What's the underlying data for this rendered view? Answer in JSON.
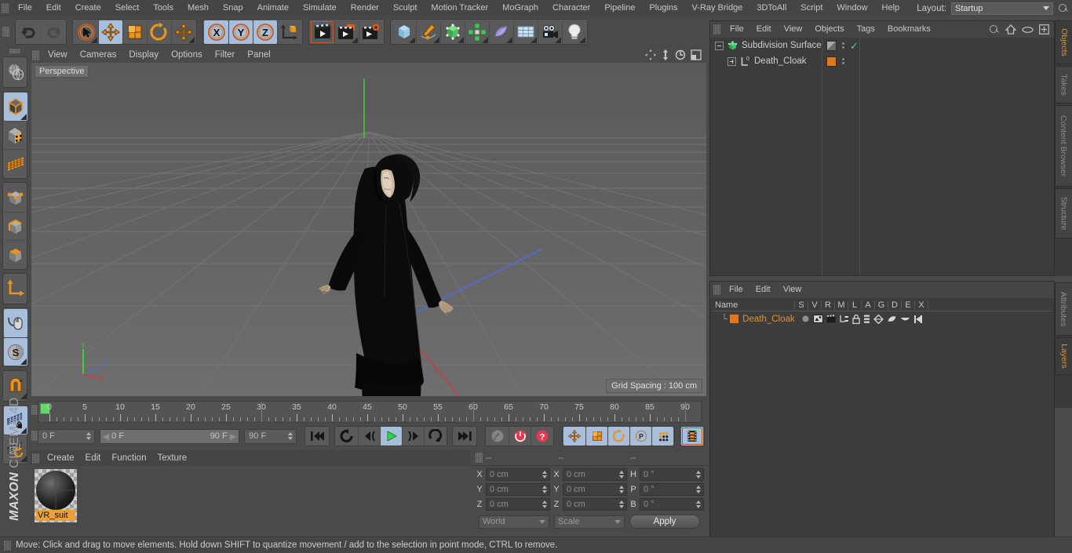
{
  "app": {
    "title": "MAXON CINEMA 4D",
    "brand_bold": "MAXON",
    "brand_light": "CINEMA 4D"
  },
  "menu": {
    "items": [
      "File",
      "Edit",
      "Create",
      "Select",
      "Tools",
      "Mesh",
      "Snap",
      "Animate",
      "Simulate",
      "Render",
      "Sculpt",
      "Motion Tracker",
      "MoGraph",
      "Character",
      "Pipeline",
      "Plugins",
      "V-Ray Bridge",
      "3DToAll",
      "Script",
      "Window",
      "Help"
    ],
    "layout_label": "Layout:",
    "layout_value": "Startup",
    "search_icon": "search-icon"
  },
  "toolbar": {
    "groups": [
      {
        "name": "undo-redo",
        "buttons": [
          {
            "name": "undo-button",
            "icon": "undo-arrow-icon",
            "active": false
          },
          {
            "name": "redo-button",
            "icon": "redo-arrow-icon",
            "active": false,
            "disabled": true
          }
        ]
      },
      {
        "name": "transform-tools",
        "buttons": [
          {
            "name": "live-selection-tool",
            "icon": "cursor-circle-icon",
            "active": false,
            "corner": true
          },
          {
            "name": "move-tool",
            "icon": "move-arrows-icon",
            "active": true
          },
          {
            "name": "scale-tool",
            "icon": "scale-box-icon",
            "active": false
          },
          {
            "name": "rotate-tool",
            "icon": "rotate-arc-icon",
            "active": false
          },
          {
            "name": "move-extra-tool",
            "icon": "move-arrows-icon",
            "active": false,
            "corner": true
          }
        ]
      },
      {
        "name": "axis-locks",
        "buttons": [
          {
            "name": "lock-x-axis",
            "icon": "x-axis-icon",
            "active": true,
            "label": "X"
          },
          {
            "name": "lock-y-axis",
            "icon": "y-axis-icon",
            "active": true,
            "label": "Y"
          },
          {
            "name": "lock-z-axis",
            "icon": "z-axis-icon",
            "active": true,
            "label": "Z"
          },
          {
            "name": "world-object-coordinate-toggle",
            "icon": "world-axis-cube-icon",
            "active": false
          }
        ]
      },
      {
        "name": "render-tools",
        "buttons": [
          {
            "name": "render-view-button",
            "icon": "clapper-frame-icon",
            "active": false,
            "highlight": true
          },
          {
            "name": "render-picture-viewer-button",
            "icon": "clapper-window-icon",
            "active": false,
            "corner": true
          },
          {
            "name": "render-settings-button",
            "icon": "clapper-gear-icon",
            "active": false
          }
        ]
      },
      {
        "name": "object-creation",
        "buttons": [
          {
            "name": "add-cube-primitive",
            "icon": "blue-cube-icon",
            "active": false,
            "corner": true
          },
          {
            "name": "add-spline",
            "icon": "pen-spline-icon",
            "active": false,
            "corner": true
          },
          {
            "name": "add-generator",
            "icon": "green-cube-nurbs-icon",
            "active": false,
            "corner": true
          },
          {
            "name": "add-array-object",
            "icon": "green-cluster-icon",
            "active": false,
            "corner": true
          },
          {
            "name": "add-deformer",
            "icon": "purple-bend-icon",
            "active": false,
            "corner": true
          },
          {
            "name": "add-environment",
            "icon": "grid-floor-icon",
            "active": false,
            "corner": true
          },
          {
            "name": "add-camera",
            "icon": "camera-icon",
            "active": false,
            "corner": true
          },
          {
            "name": "add-light",
            "icon": "light-bulb-icon",
            "active": false,
            "corner": true
          }
        ]
      }
    ]
  },
  "left_toolbar": {
    "groups": [
      {
        "buttons": [
          {
            "name": "make-editable-button",
            "icon": "sphere-wire-icon",
            "active": false
          }
        ]
      },
      {
        "buttons": [
          {
            "name": "model-mode-button",
            "icon": "model-cube-icon",
            "active": true,
            "corner": true
          },
          {
            "name": "texture-mode-button",
            "icon": "texture-checker-cube-icon",
            "active": false
          },
          {
            "name": "uv-mesh-mode-button",
            "icon": "uv-mesh-icon",
            "active": false
          }
        ]
      },
      {
        "buttons": [
          {
            "name": "point-mode-button",
            "icon": "point-cube-icon",
            "active": false
          },
          {
            "name": "edge-mode-button",
            "icon": "edge-cube-icon",
            "active": false
          },
          {
            "name": "polygon-mode-button",
            "icon": "polygon-cube-icon",
            "active": false
          }
        ]
      },
      {
        "buttons": [
          {
            "name": "axis-modify-button",
            "icon": "axis-corner-icon",
            "active": false
          }
        ]
      },
      {
        "buttons": [
          {
            "name": "enable-snap-button",
            "icon": "mouse-snap-icon",
            "active": true
          },
          {
            "name": "soft-selection-button",
            "icon": "soft-selection-s-icon",
            "active": true,
            "corner": true
          }
        ]
      },
      {
        "buttons": [
          {
            "name": "magnet-tool-button",
            "icon": "magnet-icon",
            "active": false,
            "corner": true
          }
        ]
      },
      {
        "buttons": [
          {
            "name": "lock-workplane-button",
            "icon": "workplane-lock-icon",
            "active": true,
            "corner": true
          },
          {
            "name": "planar-workplane-button",
            "icon": "workplane-rotate-icon",
            "active": false,
            "corner": true
          }
        ]
      }
    ]
  },
  "viewport": {
    "menu": [
      "View",
      "Cameras",
      "Display",
      "Options",
      "Filter",
      "Panel"
    ],
    "icons": [
      "move-view-icon",
      "zoom-view-icon",
      "rotate-view-icon",
      "maximize-view-icon"
    ],
    "label": "Perspective",
    "grid_spacing": "Grid Spacing : 100 cm",
    "axis_gizmo": {
      "y": "Y",
      "z": "Z",
      "x": "X",
      "y_color": "#3ecf3e",
      "z_color": "#4a6fe8",
      "x_color": "#e04040"
    },
    "object_name": "Death_Cloak"
  },
  "timeline": {
    "tick_labels": [
      "0",
      "5",
      "10",
      "15",
      "20",
      "25",
      "30",
      "35",
      "40",
      "45",
      "50",
      "55",
      "60",
      "65",
      "70",
      "75",
      "80",
      "85",
      "90"
    ],
    "tick_values": [
      0,
      5,
      10,
      15,
      20,
      25,
      30,
      35,
      40,
      45,
      50,
      55,
      60,
      65,
      70,
      75,
      80,
      85,
      90
    ],
    "range_min": 0,
    "range_max": 90,
    "current_frame": "0 F",
    "preview_min": "0 F",
    "preview_max": "90 F",
    "document_end": "90 F",
    "current_frame_right": "0 F",
    "controls": [
      {
        "name": "go-to-start-button",
        "icon": "skip-start-icon"
      },
      {
        "name": "play-backwards-button",
        "icon": "loop-back-icon"
      },
      {
        "name": "step-back-button",
        "icon": "step-back-icon"
      },
      {
        "name": "play-forward-button",
        "icon": "play-icon",
        "active": true
      },
      {
        "name": "step-forward-button",
        "icon": "step-forward-icon"
      },
      {
        "name": "play-loop-button",
        "icon": "loop-forward-icon"
      },
      {
        "name": "go-to-end-button",
        "icon": "skip-end-icon"
      },
      {
        "name": "record-active-objects-button",
        "icon": "key-disabled-icon"
      },
      {
        "name": "autokeying-button",
        "icon": "record-red-icon"
      },
      {
        "name": "keyframe-selection-button",
        "icon": "question-red-icon"
      },
      {
        "name": "position-key-button",
        "icon": "move-arrows-icon",
        "active": true
      },
      {
        "name": "scale-key-button",
        "icon": "scale-box-icon",
        "active": true
      },
      {
        "name": "rotation-key-button",
        "icon": "rotate-arc-icon",
        "active": true
      },
      {
        "name": "param-key-button",
        "icon": "p-circle-icon",
        "active": true
      },
      {
        "name": "point-level-animation-button",
        "icon": "dots-grid-icon",
        "active": true
      },
      {
        "name": "timeline-mode-button",
        "icon": "filmstrip-icon",
        "active": true,
        "highlight": true
      }
    ]
  },
  "materials": {
    "menu": [
      "Create",
      "Edit",
      "Function",
      "Texture"
    ],
    "items": [
      {
        "name": "VR_suit",
        "selected": true
      }
    ]
  },
  "coordinates": {
    "headers": [
      "--",
      "--",
      "--"
    ],
    "rows": [
      {
        "label_pos": "X",
        "pos": "0 cm",
        "label_size": "X",
        "size": "0 cm",
        "label_rot": "H",
        "rot": "0 °"
      },
      {
        "label_pos": "Y",
        "pos": "0 cm",
        "label_size": "Y",
        "size": "0 cm",
        "label_rot": "P",
        "rot": "0 °"
      },
      {
        "label_pos": "Z",
        "pos": "0 cm",
        "label_size": "Z",
        "size": "0 cm",
        "label_rot": "B",
        "rot": "0 °"
      }
    ],
    "coord_system": "World",
    "size_mode": "Scale",
    "apply_label": "Apply"
  },
  "object_manager": {
    "menu": [
      "File",
      "Edit",
      "View",
      "Objects",
      "Tags",
      "Bookmarks"
    ],
    "icons": [
      "search-icon",
      "home-icon",
      "eye-icon",
      "add-layer-icon"
    ],
    "items": [
      {
        "name": "Subdivision Surface",
        "icon": "subdivision-surface-icon",
        "icon_color": "#3ecf6b",
        "depth": 0,
        "expander": "minus",
        "tag_color": "#8f8f8f",
        "check": true
      },
      {
        "name": "Death_Cloak",
        "icon": "polygon-object-icon",
        "icon_color": "#cfcfcf",
        "depth": 1,
        "expander": "plus",
        "tag_color": "#e07820",
        "check": false
      }
    ]
  },
  "layer_manager": {
    "menu": [
      "File",
      "Edit",
      "View"
    ],
    "columns": [
      "Name",
      "S",
      "V",
      "R",
      "M",
      "L",
      "A",
      "G",
      "D",
      "E",
      "X"
    ],
    "rows": [
      {
        "name": "Death_Cloak",
        "swatch": "#e07820",
        "icons": [
          "solo-dot-icon",
          "visible-icon",
          "render-icon",
          "manager-icon",
          "lock-icon",
          "animation-icon",
          "generator-icon",
          "deformer-icon",
          "expression-icon",
          "xref-icon"
        ]
      }
    ]
  },
  "right_tabs": {
    "upper": [
      {
        "label": "Objects",
        "active": true
      },
      {
        "label": "Takes",
        "active": false
      },
      {
        "label": "Content Browser",
        "active": false
      },
      {
        "label": "Structure",
        "active": false
      }
    ],
    "lower": [
      {
        "label": "Attributes",
        "active": false
      },
      {
        "label": "Layers",
        "active": true
      }
    ]
  },
  "statusbar": {
    "text": "Move: Click and drag to move elements. Hold down SHIFT to quantize movement / add to the selection in point mode, CTRL to remove."
  },
  "colors": {
    "accent_orange": "#e2902e",
    "active_blue": "#a7bedd",
    "panel_bg": "#4a4a4a",
    "dark_bg": "#3c3c3c",
    "green": "#3ecf6b"
  }
}
